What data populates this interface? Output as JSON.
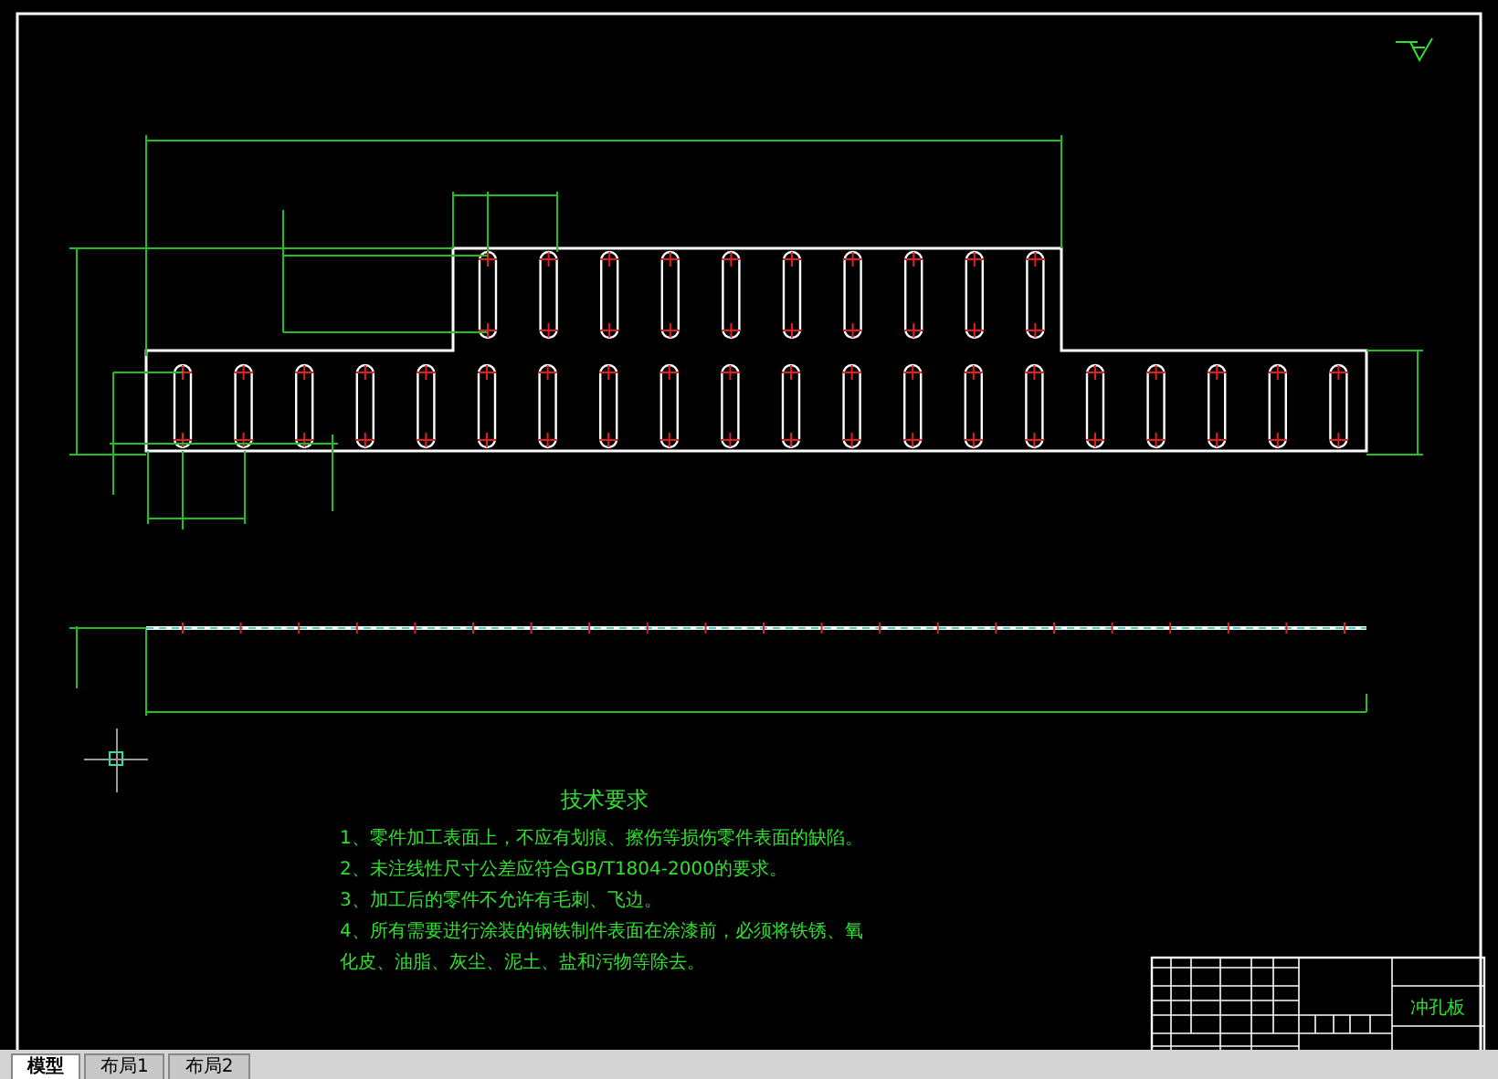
{
  "drawing": {
    "notes_title": "技术要求",
    "notes": [
      "1、零件加工表面上，不应有划痕、擦伤等损伤零件表面的缺陷。",
      "2、未注线性尺寸公差应符合GB/T1804-2000的要求。",
      "3、加工后的零件不允许有毛刺、飞边。",
      "4、所有需要进行涂装的钢铁制件表面在涂漆前，必须将铁锈、氧化皮、油脂、灰尘、泥土、盐和污物等除去。"
    ],
    "title_block": {
      "part_name": "冲孔板"
    }
  },
  "layout_tabs": [
    {
      "label": "模型",
      "selected": true
    },
    {
      "label": "布局1",
      "selected": false
    },
    {
      "label": "布局2",
      "selected": false
    }
  ]
}
